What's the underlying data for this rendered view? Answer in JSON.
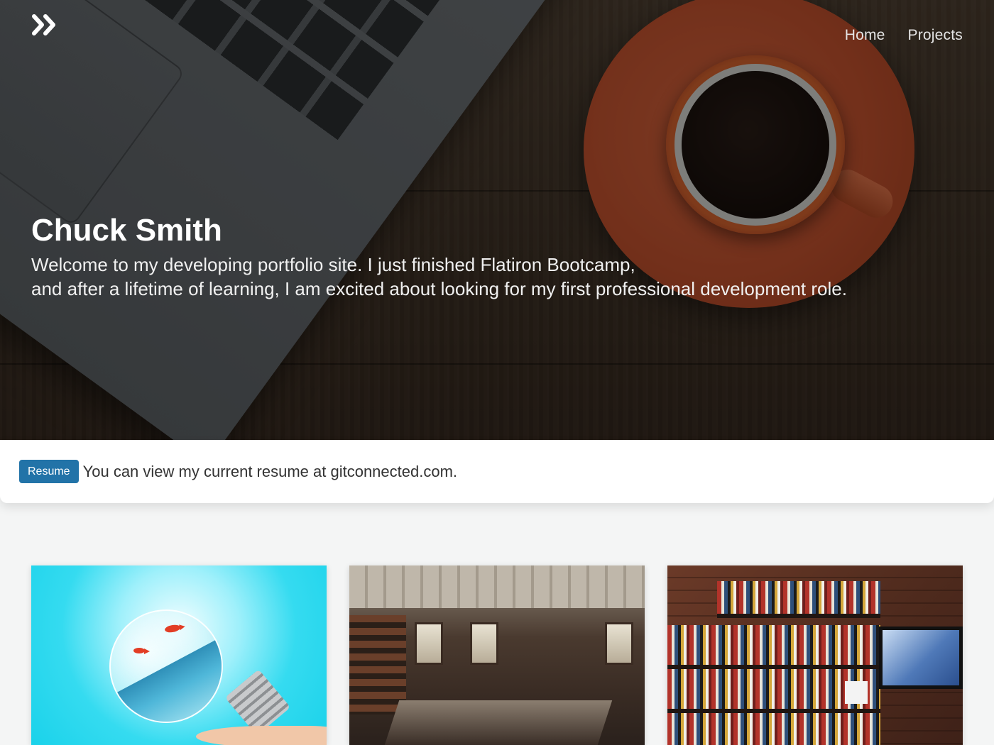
{
  "brand": {
    "logo_icon": "double-chevron-right-icon"
  },
  "nav": {
    "items": [
      {
        "label": "Home"
      },
      {
        "label": "Projects"
      }
    ]
  },
  "hero": {
    "name": "Chuck Smith",
    "tagline_line1": "Welcome to my developing portfolio site. I just finished Flatiron Bootcamp,",
    "tagline_line2": "and after a lifetime of learning, I am excited about looking for my first professional development role."
  },
  "resume": {
    "button_label": "Resume",
    "text": "You can view my current resume at gitconnected.com."
  },
  "colors": {
    "accent": "#2273a8",
    "page_background": "#f4f5f5"
  }
}
